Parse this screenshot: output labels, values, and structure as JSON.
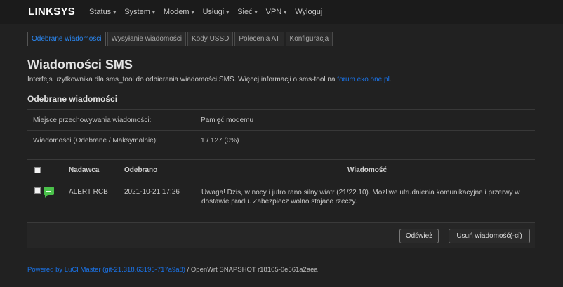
{
  "navbar": {
    "brand": "LINKSYS",
    "menu": [
      {
        "label": "Status",
        "dropdown": true
      },
      {
        "label": "System",
        "dropdown": true
      },
      {
        "label": "Modem",
        "dropdown": true
      },
      {
        "label": "Usługi",
        "dropdown": true
      },
      {
        "label": "Sieć",
        "dropdown": true
      },
      {
        "label": "VPN",
        "dropdown": true
      },
      {
        "label": "Wyloguj",
        "dropdown": false
      }
    ]
  },
  "tabs": [
    {
      "label": "Odebrane wiadomości",
      "active": true
    },
    {
      "label": "Wysyłanie wiadomości",
      "active": false
    },
    {
      "label": "Kody USSD",
      "active": false
    },
    {
      "label": "Polecenia AT",
      "active": false
    },
    {
      "label": "Konfiguracja",
      "active": false
    }
  ],
  "page": {
    "title": "Wiadomości SMS",
    "description_prefix": "Interfejs użytkownika dla sms_tool do odbierania wiadomości SMS. Więcej informacji o sms-tool na ",
    "description_link": "forum eko.one.pl",
    "description_suffix": ".",
    "section_title": "Odebrane wiadomości"
  },
  "info": [
    {
      "label": "Miejsce przechowywania wiadomości:",
      "value": "Pamięć modemu"
    },
    {
      "label": "Wiadomości (Odebrane / Maksymalnie):",
      "value": "1 / 127 (0%)"
    }
  ],
  "table": {
    "headers": {
      "sender": "Nadawca",
      "received": "Odebrano",
      "message": "Wiadomość"
    },
    "rows": [
      {
        "sender": "ALERT RCB",
        "received": "2021-10-21 17:26",
        "message": "Uwaga! Dzis, w nocy i jutro rano silny wiatr (21/22.10). Mozliwe utrudnienia komunikacyjne i przerwy w dostawie pradu. Zabezpiecz wolno stojace rzeczy."
      }
    ]
  },
  "actions": {
    "refresh_label": "Odśwież",
    "delete_label": "Usuń wiadomość(-ci)"
  },
  "footer": {
    "link": "Powered by LuCI Master (git-21.318.63196-717a9a8)",
    "text": " / OpenWrt SNAPSHOT r18105-0e561a2aea"
  },
  "colors": {
    "background": "#212121",
    "link": "#1a73e8",
    "active_tab": "#2a86f0",
    "sms_icon": "#4ac14a"
  }
}
